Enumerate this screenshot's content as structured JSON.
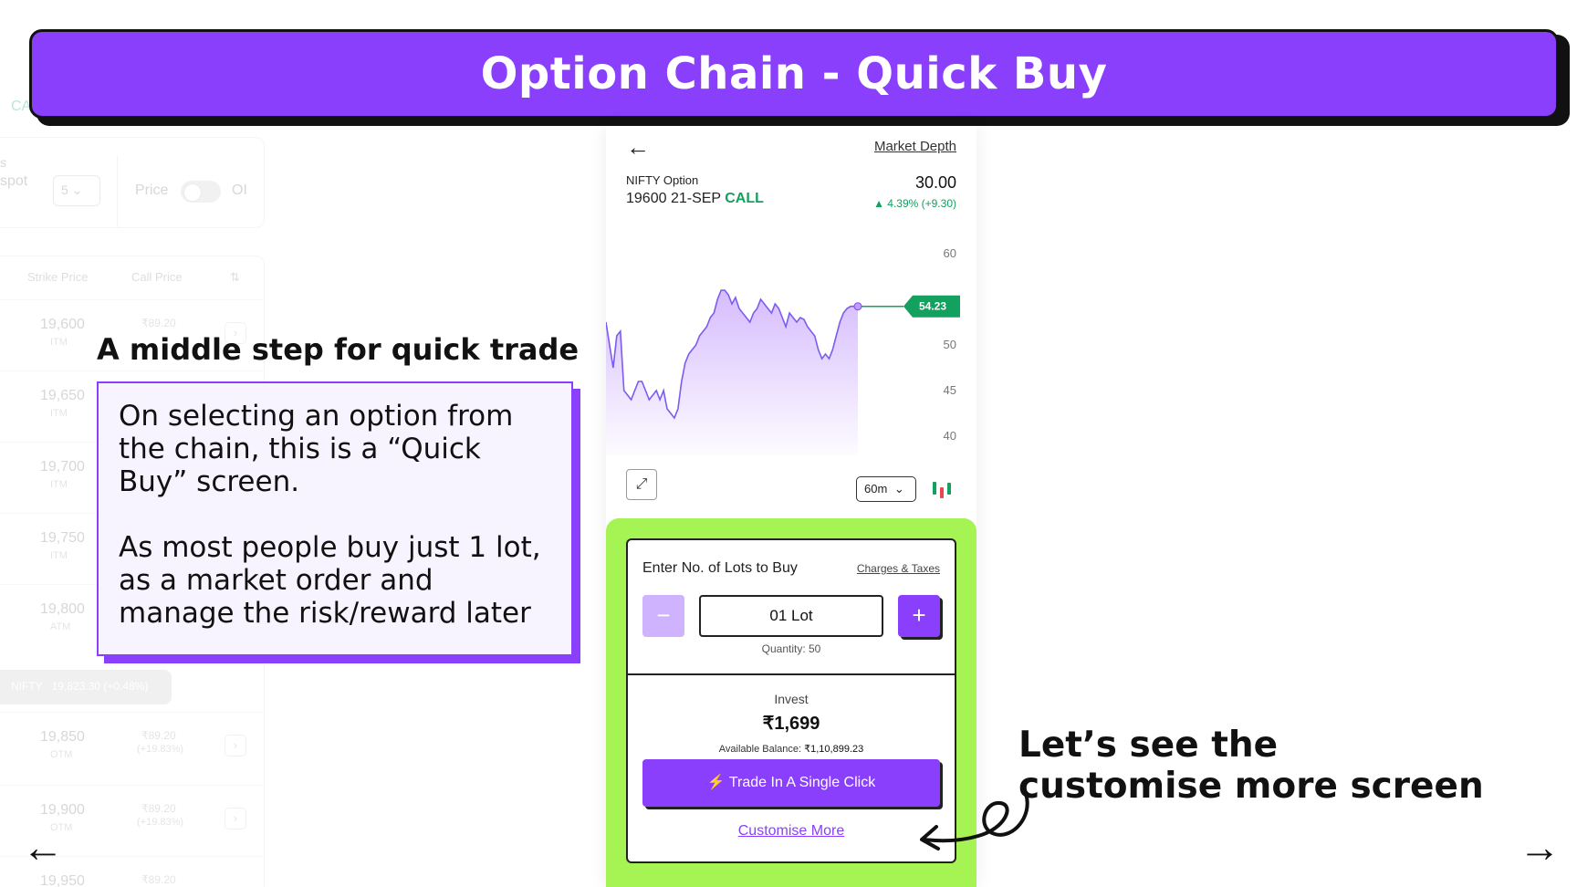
{
  "banner": {
    "title": "Option Chain - Quick Buy"
  },
  "background_chain": {
    "tab_partial": "CA",
    "spot_label_lines": [
      "s",
      "spot"
    ],
    "strikes_count_value": "5",
    "toggle_left_label": "Price",
    "toggle_right_label": "OI",
    "col_strike": "Strike Price",
    "col_call": "Call Price",
    "rows": [
      {
        "strike": "19,600",
        "tag": "ITM",
        "price": "₹89.20",
        "change": ""
      },
      {
        "strike": "19,650",
        "tag": "ITM",
        "price": "",
        "change": ""
      },
      {
        "strike": "19,700",
        "tag": "ITM",
        "price": "",
        "change": ""
      },
      {
        "strike": "19,750",
        "tag": "ITM",
        "price": "",
        "change": ""
      },
      {
        "strike": "19,800",
        "tag": "ATM",
        "price": "",
        "change": ""
      },
      {
        "strike": "19,850",
        "tag": "OTM",
        "price": "₹89.20",
        "change": "(+19.83%)"
      },
      {
        "strike": "19,900",
        "tag": "OTM",
        "price": "₹89.20",
        "change": "(+19.83%)"
      },
      {
        "strike": "19,950",
        "tag": "",
        "price": "₹89.20",
        "change": ""
      }
    ],
    "spot_pill": {
      "name": "NIFTY",
      "value": "19,823.30",
      "change": "(+0.48%)"
    }
  },
  "annotation_left": {
    "title": "A middle step for quick trade",
    "para1": "On selecting an option from the chain, this is a “Quick Buy” screen.",
    "para2": "As most people buy just 1 lot, as a market order and manage the risk/reward later"
  },
  "annotation_right": {
    "text": "Let’s see the customise more screen"
  },
  "nav": {
    "prev_icon": "arrow-left-icon",
    "next_icon": "arrow-right-icon",
    "prev": "←",
    "next": "→"
  },
  "phone": {
    "back": "←",
    "market_depth": "Market Depth",
    "instrument": "NIFTY Option",
    "strike_expiry": "19600 21-SEP",
    "option_type": "CALL",
    "ltp": "30.00",
    "change": "▲ 4.39% (+9.30)",
    "chart_interval": "60m",
    "colors": {
      "accent": "#8a3ffc",
      "up": "#14a05e",
      "panel": "#a6f454"
    },
    "quick_buy": {
      "title": "Enter No. of Lots to Buy",
      "charges_link": "Charges & Taxes",
      "minus": "−",
      "lots_value": "01 Lot",
      "plus": "+",
      "quantity": "Quantity: 50",
      "invest_label": "Invest",
      "invest_value": "₹1,699",
      "balance_label": "Available Balance:",
      "balance_value": "₹1,10,899.23",
      "trade_button": "Trade In A Single Click",
      "customise_link": "Customise More"
    }
  },
  "chart_data": {
    "type": "area",
    "title": "",
    "xlabel": "",
    "ylabel": "",
    "ylim": [
      38,
      62
    ],
    "y_ticks": [
      "60",
      "50",
      "45",
      "40"
    ],
    "current_value_label": "54.23",
    "x": [
      0,
      1,
      2,
      3,
      4,
      5,
      6,
      7,
      8,
      9,
      10,
      11,
      12,
      13,
      14,
      15,
      16,
      17,
      18,
      19,
      20,
      21,
      22,
      23,
      24,
      25,
      26,
      27,
      28,
      29,
      30,
      31,
      32,
      33,
      34,
      35,
      36,
      37,
      38,
      39,
      40,
      41,
      42,
      43,
      44,
      45,
      46,
      47,
      48,
      49,
      50,
      51,
      52,
      53,
      54,
      55,
      56,
      57,
      58,
      59,
      60,
      61,
      62,
      63,
      64,
      65,
      66,
      67,
      68,
      69,
      70
    ],
    "values": [
      52.5,
      50,
      47.5,
      51,
      51.5,
      45,
      44.5,
      44,
      45,
      46,
      46,
      45,
      44,
      44.5,
      45,
      44,
      45,
      43,
      42.5,
      42,
      43,
      46,
      48,
      49,
      49.5,
      50,
      51,
      51.5,
      52,
      53,
      53.5,
      55,
      56,
      56,
      55.5,
      54.5,
      55.2,
      54,
      53.5,
      53,
      52.5,
      53.5,
      54,
      55,
      54.5,
      54,
      53.5,
      54.5,
      54,
      53,
      52,
      53.5,
      53,
      52.5,
      53,
      52.8,
      52,
      51.5,
      51,
      49.5,
      48.5,
      49,
      48.5,
      49.5,
      51,
      52.5,
      53.5,
      54,
      54.23,
      54.23,
      54.23
    ]
  }
}
